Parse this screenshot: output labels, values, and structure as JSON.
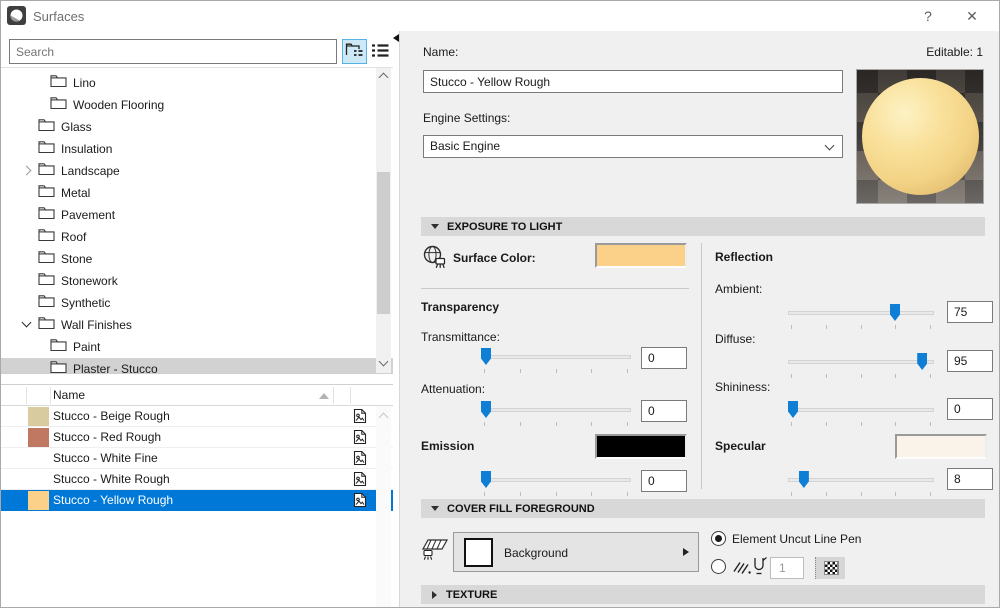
{
  "window": {
    "title": "Surfaces",
    "help": "?",
    "close": "✕"
  },
  "colors": {
    "selection_blue": "#0078d7",
    "surface_yellow": "#fbd189",
    "beige": "#d9cba0",
    "red": "#c17863",
    "white": "#ffffff",
    "emission_black": "#000000",
    "specular_cream": "#faf3e9"
  },
  "icons": {
    "app": "surface-sphere",
    "view_tree": "folder-tree",
    "view_list": "list-lines",
    "tree_item": "folder",
    "row": "texture-picture",
    "surface_color": "sphere-paintbrush",
    "cover_fill": "fill-hatch-brush",
    "pen": "pen-nib",
    "hatch": "diagonal-hatch"
  },
  "left": {
    "search_placeholder": "Search",
    "tree": [
      {
        "label": "Lino"
      },
      {
        "label": "Wooden Flooring"
      },
      {
        "label": "Glass"
      },
      {
        "label": "Insulation"
      },
      {
        "label": "Landscape",
        "expander": "collapsed"
      },
      {
        "label": "Metal"
      },
      {
        "label": "Pavement"
      },
      {
        "label": "Roof"
      },
      {
        "label": "Stone"
      },
      {
        "label": "Stonework"
      },
      {
        "label": "Synthetic"
      },
      {
        "label": "Wall Finishes",
        "expander": "expanded"
      },
      {
        "label": "Paint"
      },
      {
        "label": "Plaster - Stucco",
        "selected": true
      }
    ],
    "list": {
      "header": "Name",
      "rows": [
        {
          "name": "Stucco - Beige Rough",
          "swatch": "#d9cba0"
        },
        {
          "name": "Stucco - Red Rough",
          "swatch": "#c17863"
        },
        {
          "name": "Stucco - White Fine",
          "swatch": "#ffffff"
        },
        {
          "name": "Stucco - White Rough",
          "swatch": "#ffffff"
        },
        {
          "name": "Stucco - Yellow Rough",
          "swatch": "#fbd189",
          "selected": true
        }
      ]
    }
  },
  "right": {
    "editable": "Editable: 1",
    "name_label": "Name:",
    "name_value": "Stucco - Yellow Rough",
    "engine_label": "Engine Settings:",
    "engine_value": "Basic Engine",
    "sections": {
      "exposure": "EXPOSURE TO LIGHT",
      "cover_fill": "COVER FILL FOREGROUND",
      "texture": "TEXTURE"
    },
    "surface_color_label": "Surface Color:",
    "surface_color": "#fbd189",
    "transparency_label": "Transparency",
    "transmittance": {
      "label": "Transmittance:",
      "value": "0",
      "pct": 0
    },
    "attenuation": {
      "label": "Attenuation:",
      "value": "0",
      "pct": 0
    },
    "emission_label": "Emission",
    "emission_color": "#000000",
    "emission": {
      "value": "0",
      "pct": 0
    },
    "reflection_label": "Reflection",
    "ambient": {
      "label": "Ambient:",
      "value": "75",
      "pct": 75
    },
    "diffuse": {
      "label": "Diffuse:",
      "value": "95",
      "pct": 95
    },
    "shininess": {
      "label": "Shininess:",
      "value": "0",
      "pct": 0
    },
    "specular_label": "Specular",
    "specular_color": "#faf3e9",
    "specular": {
      "value": "8",
      "pct": 8
    },
    "fill_button_label": "Background",
    "radio1_label": "Element Uncut Line Pen",
    "pen_value": "1"
  }
}
